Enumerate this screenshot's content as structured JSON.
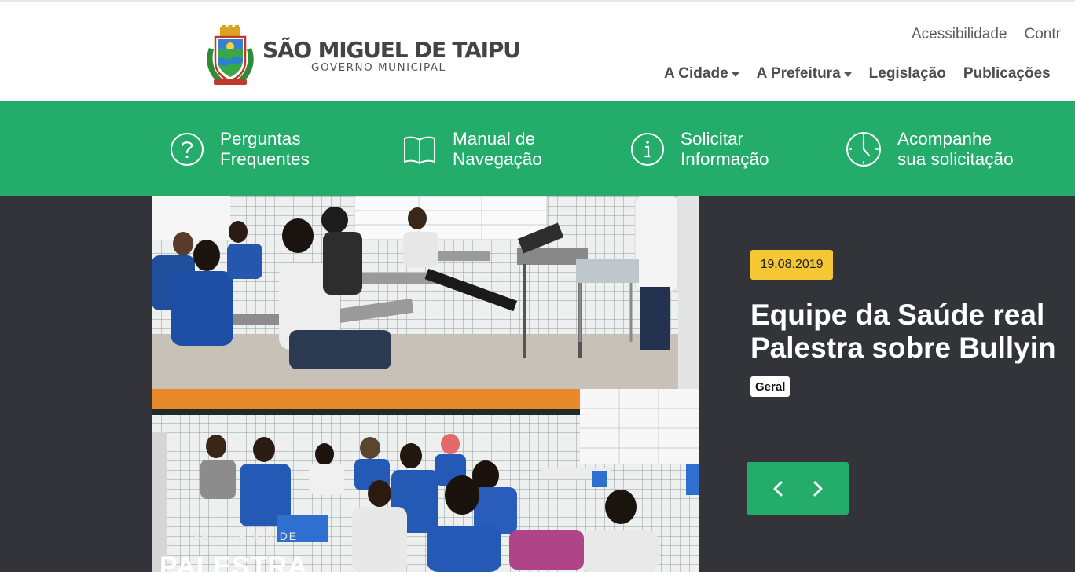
{
  "header": {
    "logo_title": "SÃO MIGUEL DE TAIPU",
    "logo_subtitle": "GOVERNO MUNICIPAL",
    "top_links": [
      {
        "label": "Acessibilidade"
      },
      {
        "label": "Contr"
      }
    ],
    "main_nav": [
      {
        "label": "A Cidade",
        "dropdown": true
      },
      {
        "label": "A Prefeitura",
        "dropdown": true
      },
      {
        "label": "Legislação",
        "dropdown": false
      },
      {
        "label": "Publicações",
        "dropdown": false
      }
    ]
  },
  "services": [
    {
      "icon": "question-circle-icon",
      "label": "Perguntas\nFrequentes"
    },
    {
      "icon": "open-book-icon",
      "label": "Manual de\nNavegação"
    },
    {
      "icon": "info-circle-icon",
      "label": "Solicitar\nInformação"
    },
    {
      "icon": "clock-icon",
      "label": "Acompanhe\nsua solicitação"
    }
  ],
  "carousel": {
    "photo_caption_small": "SEC. DE SAÚDE",
    "photo_caption_big": "PALESTRA",
    "date": "19.08.2019",
    "headline_line1": "Equipe da Saúde real",
    "headline_line2": "Palestra sobre Bullyin",
    "category": "Geral",
    "prev_icon": "chevron-left-icon",
    "next_icon": "chevron-right-icon"
  },
  "colors": {
    "brand_green": "#24ad6a",
    "carousel_bg": "#32343a",
    "date_badge": "#f6c735"
  }
}
